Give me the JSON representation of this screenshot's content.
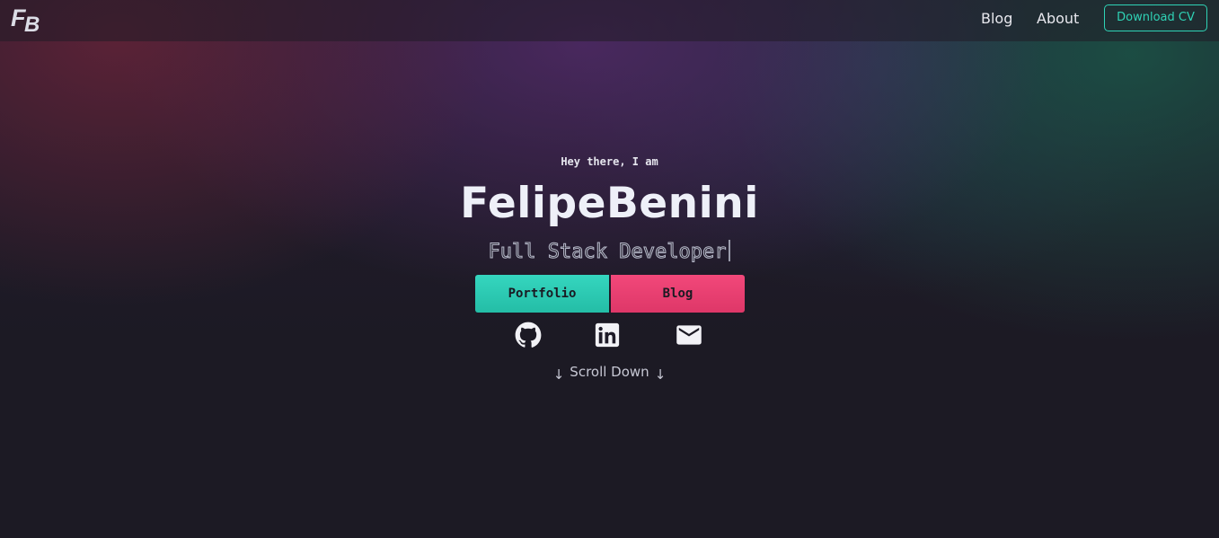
{
  "header": {
    "logo_text": "FB",
    "nav": {
      "blog_label": "Blog",
      "about_label": "About"
    },
    "download_cv_label": "Download CV"
  },
  "hero": {
    "greeting": "Hey there, I am",
    "name": "FelipeBenini",
    "role": "Full Stack Developer",
    "buttons": {
      "portfolio_label": "Portfolio",
      "blog_label": "Blog"
    },
    "social": [
      {
        "icon": "github-icon"
      },
      {
        "icon": "linkedin-icon"
      },
      {
        "icon": "mail-icon"
      }
    ],
    "scroll": {
      "label": "Scroll Down",
      "arrow": "↓"
    }
  },
  "colors": {
    "accent_teal": "#2fd3b6",
    "accent_pink": "#f2487a",
    "background": "#1c1a24",
    "text": "#eef0f8"
  }
}
